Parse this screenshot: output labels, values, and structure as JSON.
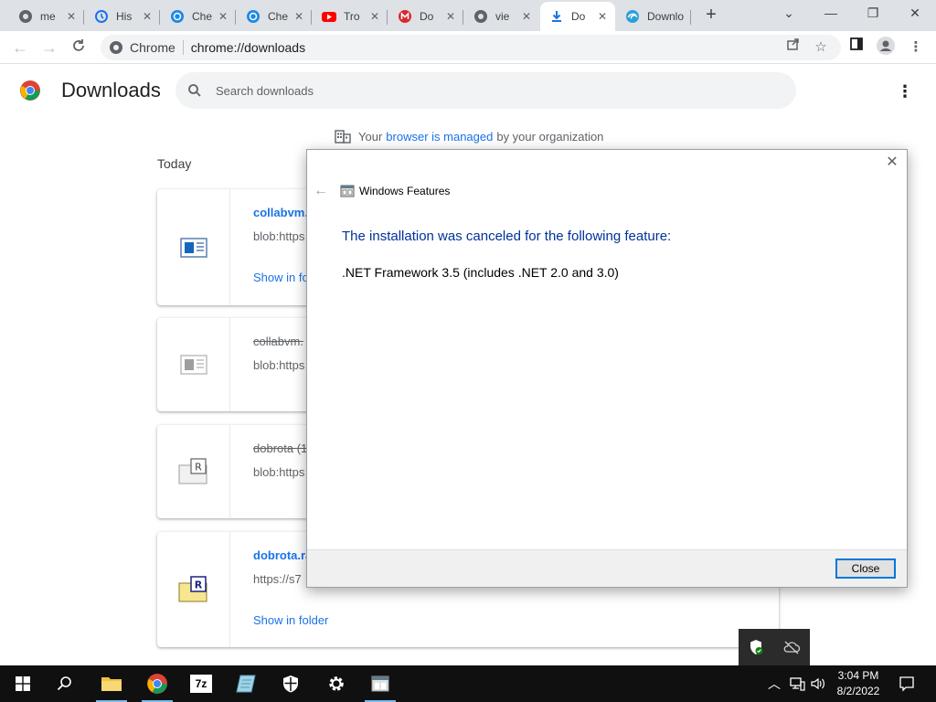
{
  "browser": {
    "tabs": [
      {
        "title": "me",
        "icon": "chrome-icon"
      },
      {
        "title": "His",
        "icon": "history-icon"
      },
      {
        "title": "Che",
        "icon": "chatgpt-icon"
      },
      {
        "title": "Che",
        "icon": "chatgpt-icon"
      },
      {
        "title": "Tro",
        "icon": "youtube-icon"
      },
      {
        "title": "Do",
        "icon": "mega-icon"
      },
      {
        "title": "vie",
        "icon": "chrome-icon"
      },
      {
        "title": "Do",
        "icon": "download-icon",
        "active": true
      },
      {
        "title": "Downlo",
        "icon": "edge-icon"
      }
    ],
    "new_tab_label": "+",
    "window_controls": {
      "chevron": "⌄",
      "minimize": "—",
      "restore": "❐",
      "close": "✕"
    },
    "omnibox": {
      "site_label": "Chrome",
      "url": "chrome://downloads"
    }
  },
  "downloads": {
    "title": "Downloads",
    "search_placeholder": "Search downloads",
    "managed_prefix": "Your",
    "managed_link": "browser is managed",
    "managed_suffix": "by your organization",
    "section_label": "Today",
    "items": [
      {
        "name": "collabvm.",
        "url": "blob:https",
        "link": "Show in fo"
      },
      {
        "name": "collabvm.",
        "url": "blob:https"
      },
      {
        "name": "dobrota (1",
        "url": "blob:https"
      },
      {
        "name": "dobrota.ra",
        "url": "https://s7",
        "link": "Show in folder"
      }
    ]
  },
  "dialog": {
    "title": "Windows Features",
    "message": "The installation was canceled for the following feature:",
    "feature": ".NET Framework 3.5 (includes .NET 2.0 and 3.0)",
    "close_button": "Close"
  },
  "taskbar": {
    "time": "3:04 PM",
    "date": "8/2/2022",
    "sevenzip_label": "7z",
    "colors": {
      "accent": "#0078d7",
      "taskbar": "#101010"
    }
  }
}
